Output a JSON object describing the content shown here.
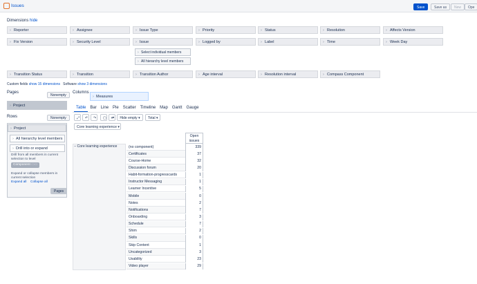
{
  "header": {
    "title": "Issues",
    "buttons": [
      "Save",
      "Save as",
      "New",
      "Ope"
    ]
  },
  "dimensions": {
    "label": "Dimensions",
    "hide_link": "hide",
    "row1": [
      "Reporter",
      "Assignee",
      "Issue Type",
      "Priority",
      "Status",
      "Resolution",
      "Affects Version"
    ],
    "row2": [
      "Fix Version",
      "Security Level",
      "Issue",
      "Logged by",
      "Label",
      "Time",
      "Week Day"
    ],
    "issue_options": [
      "Select individual members",
      "All hierarchy level members"
    ],
    "row3": [
      "Transition Status",
      "Transition",
      "Transition Author",
      "Age interval",
      "Resolution interval",
      "Compass Component"
    ],
    "custom_fields_label": "Custom fields",
    "custom_fields_link": "show 15 dimensions",
    "software_label": "Software",
    "software_link": "show 3 dimensions"
  },
  "pages": {
    "label": "Pages",
    "nonempty": "Nonempty",
    "item": "Project"
  },
  "rows": {
    "label": "Rows",
    "nonempty": "Nonempty",
    "item": "Project",
    "option_all": "All hierarchy level members",
    "option_drill": "Drill into or expand",
    "drill_text": "Drill from all members in current selection to level",
    "component_tag": "Component",
    "expand_text": "Expand or collapse members in current selection",
    "expand_all": "Expand all",
    "collapse_all": "Collapse all",
    "pages_button": "Pages"
  },
  "columns": {
    "label": "Columns",
    "measures": "Measures"
  },
  "view_tabs": [
    "Table",
    "Bar",
    "Line",
    "Pie",
    "Scatter",
    "Timeline",
    "Map",
    "Gantt",
    "Gauge"
  ],
  "toolbar": {
    "hide_empty": "Hide empty",
    "total": "Total"
  },
  "dropdown": "Core learning experience",
  "table": {
    "col_header_line1": "Open",
    "col_header_line2": "issues",
    "root_row": "Core learning experience",
    "rows": [
      {
        "label": "(no component)",
        "value": "339"
      },
      {
        "label": "Certificates",
        "value": "37"
      },
      {
        "label": "Course-Home",
        "value": "32"
      },
      {
        "label": "Discussion forum",
        "value": "20"
      },
      {
        "label": "Habit-formation-progresscards",
        "value": "1"
      },
      {
        "label": "Instructor Messaging",
        "value": "1"
      },
      {
        "label": "Learner Incentive",
        "value": "5"
      },
      {
        "label": "Mobile",
        "value": "0"
      },
      {
        "label": "Notes",
        "value": "2"
      },
      {
        "label": "Notifications",
        "value": "7"
      },
      {
        "label": "Onboarding",
        "value": "3"
      },
      {
        "label": "Schedule",
        "value": "7"
      },
      {
        "label": "Shim",
        "value": "2"
      },
      {
        "label": "Skills",
        "value": "0"
      },
      {
        "label": "Skip Content",
        "value": "1"
      },
      {
        "label": "Uncategorized",
        "value": "3"
      },
      {
        "label": "Usability",
        "value": "23"
      },
      {
        "label": "Video player",
        "value": "29"
      }
    ]
  }
}
